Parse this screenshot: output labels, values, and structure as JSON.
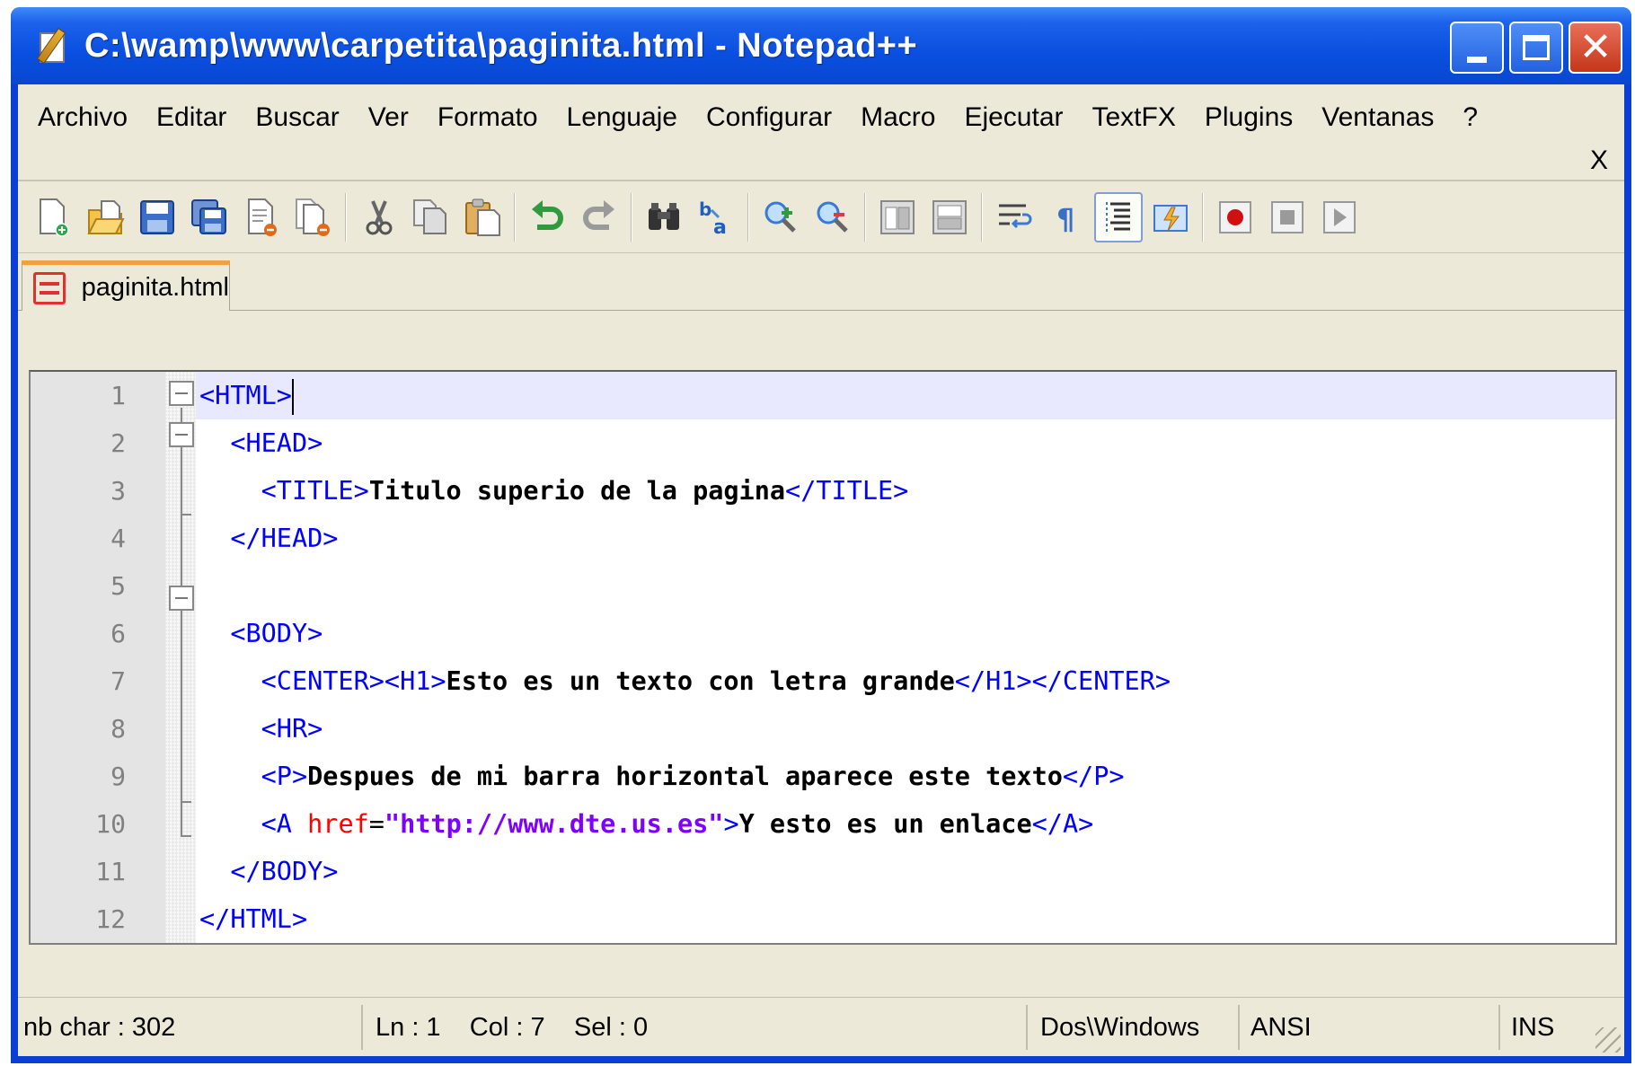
{
  "window": {
    "title": "C:\\wamp\\www\\carpetita\\paginita.html - Notepad++"
  },
  "menu": {
    "items": [
      "Archivo",
      "Editar",
      "Buscar",
      "Ver",
      "Formato",
      "Lenguaje",
      "Configurar",
      "Macro",
      "Ejecutar",
      "TextFX",
      "Plugins",
      "Ventanas",
      "?"
    ],
    "close_label": "X"
  },
  "toolbar": {
    "buttons": [
      "new-file-icon",
      "open-file-icon",
      "save-icon",
      "save-all-icon",
      "close-icon",
      "close-all-icon",
      "cut-icon",
      "copy-icon",
      "paste-icon",
      "undo-icon",
      "redo-icon",
      "find-icon",
      "replace-icon",
      "zoom-in-icon",
      "zoom-out-icon",
      "sync-vertical-icon",
      "sync-horizontal-icon",
      "word-wrap-icon",
      "show-all-chars-icon",
      "indent-guide-icon",
      "user-lang-icon",
      "record-macro-icon",
      "stop-macro-icon",
      "play-macro-icon"
    ]
  },
  "tab": {
    "label": "paginita.html"
  },
  "editor": {
    "lines": [
      {
        "n": "1"
      },
      {
        "n": "2"
      },
      {
        "n": "3"
      },
      {
        "n": "4"
      },
      {
        "n": "5"
      },
      {
        "n": "6"
      },
      {
        "n": "7"
      },
      {
        "n": "8"
      },
      {
        "n": "9"
      },
      {
        "n": "10"
      },
      {
        "n": "11"
      },
      {
        "n": "12"
      }
    ],
    "code": {
      "l1_tag": "<HTML>",
      "l2_tag": "<HEAD>",
      "l3_open": "<TITLE>",
      "l3_text": "Titulo superio de la pagina",
      "l3_close": "</TITLE>",
      "l4_tag": "</HEAD>",
      "l6_tag": "<BODY>",
      "l7_open": "<CENTER><H1>",
      "l7_text": "Esto es un texto con letra grande",
      "l7_close": "</H1></CENTER>",
      "l8_tag": "<HR>",
      "l9_open": "<P>",
      "l9_text": "Despues de mi barra horizontal aparece este texto",
      "l9_close": "</P>",
      "l10_open": "<A ",
      "l10_attr": "href",
      "l10_eq": "=",
      "l10_str": "\"http://www.dte.us.es\"",
      "l10_gt": ">",
      "l10_text": "Y esto es un enlace",
      "l10_close": "</A>",
      "l11_tag": "</BODY>",
      "l12_tag": "</HTML>"
    }
  },
  "status": {
    "nb_char": "nb char : 302",
    "ln": "Ln : 1",
    "col": "Col : 7",
    "sel": "Sel : 0",
    "eol": "Dos\\Windows",
    "encoding": "ANSI",
    "mode": "INS"
  },
  "colors": {
    "tag": "#0000ff",
    "attribute": "#ff0000",
    "string": "#8000ff",
    "text": "#000000",
    "current_line": "#e8e8ff",
    "titlebar": "#0a4fe0"
  }
}
